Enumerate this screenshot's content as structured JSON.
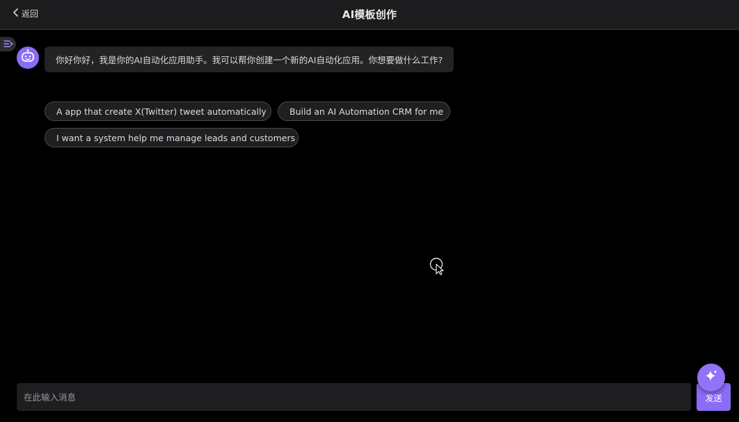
{
  "header": {
    "back_label": "返回",
    "title": "AI模板创作"
  },
  "chat": {
    "greeting": "你好你好，我是你的AI自动化应用助手。我可以帮你创建一个新的AI自动化应用。你想要做什么工作?"
  },
  "suggestions": [
    {
      "label": "A app that create X(Twitter) tweet automatically"
    },
    {
      "label": "Build an AI Automation CRM for me"
    },
    {
      "label": "I want a system help me manage leads and customers"
    }
  ],
  "composer": {
    "placeholder": "在此输入消息",
    "value": "",
    "send_label": "发送"
  },
  "colors": {
    "accent": "#8b6cf6",
    "background": "#000000",
    "header_bg": "#1c1c1e",
    "bubble_bg": "#232325"
  },
  "icons": {
    "back": "chevron-left-icon",
    "sidebar": "sidebar-toggle-icon",
    "avatar": "robot-icon",
    "fab": "sparkle-icon"
  }
}
